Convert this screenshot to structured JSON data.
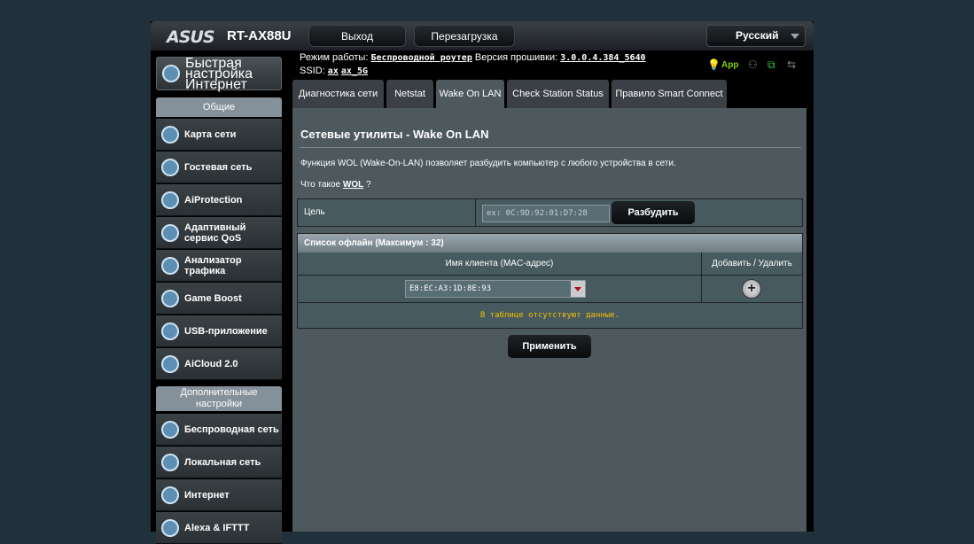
{
  "header": {
    "brand": "ASUS",
    "model": "RT-AX88U",
    "logout_label": "Выход",
    "reboot_label": "Перезагрузка",
    "language": "Русский"
  },
  "status": {
    "mode_label": "Режим работы:",
    "mode_value": "Беспроводной роутер",
    "fw_label": "Версия прошивки:",
    "fw_value": "3.0.0.4.384_5640",
    "ssid_label": "SSID:",
    "ssid_1": "ax",
    "ssid_2": "ax_5G",
    "app_label": "App"
  },
  "sidebar": {
    "quick_setup": "Быстрая настройка Интернет",
    "general_header": "Общие",
    "general_items": [
      {
        "label": "Карта сети",
        "icon": "network-map-icon"
      },
      {
        "label": "Гостевая сеть",
        "icon": "guest-network-icon"
      },
      {
        "label": "AiProtection",
        "icon": "shield-icon"
      },
      {
        "label": "Адаптивный сервис QoS",
        "icon": "speedometer-icon"
      },
      {
        "label": "Анализатор трафика",
        "icon": "traffic-analyzer-icon"
      },
      {
        "label": "Game Boost",
        "icon": "gamepad-icon"
      },
      {
        "label": "USB-приложение",
        "icon": "usb-icon"
      },
      {
        "label": "AiCloud 2.0",
        "icon": "cloud-icon"
      }
    ],
    "advanced_header": "Дополнительные настройки",
    "advanced_items": [
      {
        "label": "Беспроводная сеть",
        "icon": "wireless-icon"
      },
      {
        "label": "Локальная сеть",
        "icon": "lan-icon"
      },
      {
        "label": "Интернет",
        "icon": "globe-icon"
      },
      {
        "label": "Alexa & IFTTT",
        "icon": "alexa-icon"
      }
    ]
  },
  "tabs": [
    {
      "label": "Диагностика сети",
      "active": false
    },
    {
      "label": "Netstat",
      "active": false
    },
    {
      "label": "Wake On LAN",
      "active": true
    },
    {
      "label": "Check Station Status",
      "active": false
    },
    {
      "label": "Правило Smart Connect",
      "active": false
    }
  ],
  "main": {
    "title": "Сетевые утилиты - Wake On LAN",
    "description": "Функция WOL (Wake-On-LAN) позволяет разбудить компьютер с любого устройства в сети.",
    "what_is_prefix": "Что такое ",
    "what_is_link": "WOL",
    "what_is_suffix": " ?",
    "target_label": "Цель",
    "mac_placeholder": "ex: 0C:9D:92:01:D7:28",
    "wake_label": "Разбудить",
    "offline_list_header": "Список офлайн (Максимум : 32)",
    "col_client": "Имя клиента (MAC-адрес)",
    "col_action": "Добавить / Удалить",
    "selected_client": "E8:EC:A3:1D:8E:93",
    "empty_message": "В таблице отсутствуют данные.",
    "apply_label": "Применить"
  },
  "colors": {
    "panel_bg": "#4d595d",
    "page_bg": "#21313b",
    "empty_text": "#f4c000",
    "app_green": "#7fd300"
  }
}
